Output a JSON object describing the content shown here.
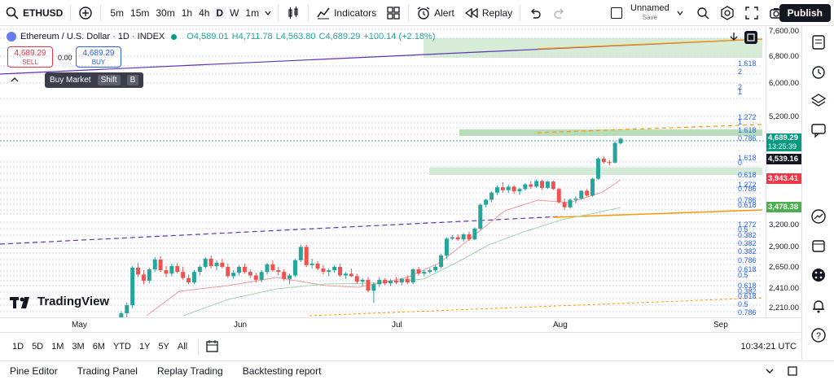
{
  "topbar": {
    "symbol": "ETHUSD",
    "timeframes": [
      "5m",
      "15m",
      "30m",
      "1h",
      "4h",
      "D",
      "W",
      "1m"
    ],
    "indicators": "Indicators",
    "alert": "Alert",
    "replay": "Replay",
    "layout_name": "Unnamed",
    "layout_state": "Save",
    "publish": "Publish"
  },
  "legend": {
    "title": "Ethereum / U.S. Dollar · 1D · INDEX",
    "open": "O4,589.01",
    "high": "H4,711.78",
    "low": "L4,563.80",
    "close": "C4,689.29",
    "change": "+100.14 (+2.18%)"
  },
  "trade": {
    "sell_price": "4,689.29",
    "sell_label": "SELL",
    "spread": "0.00",
    "buy_price": "4,689.29",
    "buy_label": "BUY"
  },
  "tooltip": {
    "action": "Buy Market",
    "key1": "Shift",
    "key2": "B"
  },
  "logo": "TradingView",
  "price_axis": {
    "ticks": [
      "7,600.00",
      "6,800.00",
      "6,000.00",
      "5,200.00",
      "3,200.00",
      "2,900.00",
      "2,650.00",
      "2,410.00",
      "2,210.00"
    ],
    "last_price": "4,689.29",
    "countdown": "13:25:39",
    "ref_price": "4,539.16",
    "red_level": "3,943.41",
    "green_level": "3,478.38"
  },
  "fib_labels": [
    "1.618",
    "2",
    "2",
    "1",
    "1.272",
    "1",
    "1.618",
    "0.786",
    "1.618",
    "0",
    "0.618",
    "1.272",
    "0.786",
    "0.786",
    "0.618",
    "1.272",
    "0.5",
    "0.382",
    "0.382",
    "0.382",
    "0.786",
    "0.618",
    "0.5",
    "0.618",
    "0.382",
    "0.618",
    "0.5",
    "0.786"
  ],
  "time_axis": [
    "May",
    "Jun",
    "Jul",
    "Aug",
    "Sep"
  ],
  "ranges": [
    "1D",
    "5D",
    "1M",
    "3M",
    "6M",
    "YTD",
    "1Y",
    "5Y",
    "All"
  ],
  "clock": "10:34:21 UTC",
  "bottom_tabs": [
    "Pine Editor",
    "Trading Panel",
    "Replay Trading",
    "Backtesting report"
  ],
  "colors": {
    "up": "#26a69a",
    "down": "#ef5350",
    "red_tag": "#f23645",
    "green_tag": "#4caf50",
    "ref_tag": "#131722",
    "last_tag": "#089981"
  },
  "chart_data": {
    "type": "candlestick",
    "x_labels": [
      "May",
      "Jun",
      "Jul",
      "Aug",
      "Sep"
    ],
    "y_range": [
      2100,
      7700
    ],
    "log_scale": true,
    "candles": [
      [
        1835,
        1990,
        1800,
        1960
      ],
      [
        1960,
        2120,
        1930,
        2100
      ],
      [
        2100,
        2210,
        2050,
        2180
      ],
      [
        2180,
        2610,
        2150,
        2590
      ],
      [
        2590,
        2650,
        2480,
        2510
      ],
      [
        2510,
        2560,
        2400,
        2440
      ],
      [
        2440,
        2590,
        2410,
        2570
      ],
      [
        2570,
        2720,
        2540,
        2690
      ],
      [
        2690,
        2730,
        2540,
        2560
      ],
      [
        2560,
        2610,
        2480,
        2520
      ],
      [
        2520,
        2640,
        2490,
        2610
      ],
      [
        2610,
        2650,
        2520,
        2540
      ],
      [
        2540,
        2600,
        2450,
        2470
      ],
      [
        2470,
        2510,
        2400,
        2420
      ],
      [
        2420,
        2560,
        2400,
        2540
      ],
      [
        2540,
        2620,
        2500,
        2600
      ],
      [
        2600,
        2720,
        2580,
        2700
      ],
      [
        2700,
        2740,
        2580,
        2610
      ],
      [
        2610,
        2680,
        2560,
        2650
      ],
      [
        2650,
        2700,
        2580,
        2600
      ],
      [
        2600,
        2640,
        2470,
        2490
      ],
      [
        2490,
        2560,
        2460,
        2530
      ],
      [
        2530,
        2620,
        2500,
        2600
      ],
      [
        2600,
        2640,
        2520,
        2540
      ],
      [
        2540,
        2570,
        2470,
        2500
      ],
      [
        2500,
        2530,
        2420,
        2450
      ],
      [
        2450,
        2560,
        2420,
        2540
      ],
      [
        2540,
        2650,
        2510,
        2630
      ],
      [
        2630,
        2680,
        2540,
        2560
      ],
      [
        2560,
        2600,
        2500,
        2540
      ],
      [
        2540,
        2570,
        2440,
        2460
      ],
      [
        2460,
        2520,
        2400,
        2500
      ],
      [
        2500,
        2700,
        2480,
        2680
      ],
      [
        2680,
        2880,
        2660,
        2850
      ],
      [
        2850,
        2880,
        2600,
        2620
      ],
      [
        2620,
        2700,
        2580,
        2640
      ],
      [
        2640,
        2670,
        2560,
        2580
      ],
      [
        2580,
        2620,
        2510,
        2540
      ],
      [
        2540,
        2580,
        2490,
        2560
      ],
      [
        2560,
        2620,
        2530,
        2600
      ],
      [
        2600,
        2640,
        2480,
        2500
      ],
      [
        2500,
        2540,
        2460,
        2520
      ],
      [
        2520,
        2580,
        2480,
        2490
      ],
      [
        2490,
        2520,
        2400,
        2430
      ],
      [
        2430,
        2470,
        2380,
        2450
      ],
      [
        2450,
        2480,
        2310,
        2330
      ],
      [
        2330,
        2420,
        2200,
        2400
      ],
      [
        2400,
        2480,
        2370,
        2450
      ],
      [
        2450,
        2470,
        2390,
        2410
      ],
      [
        2410,
        2460,
        2380,
        2440
      ],
      [
        2440,
        2480,
        2400,
        2420
      ],
      [
        2420,
        2470,
        2390,
        2460
      ],
      [
        2460,
        2500,
        2400,
        2420
      ],
      [
        2420,
        2580,
        2400,
        2570
      ],
      [
        2570,
        2600,
        2500,
        2520
      ],
      [
        2520,
        2560,
        2490,
        2540
      ],
      [
        2540,
        2580,
        2520,
        2560
      ],
      [
        2560,
        2620,
        2540,
        2600
      ],
      [
        2600,
        2760,
        2580,
        2740
      ],
      [
        2740,
        2980,
        2700,
        2960
      ],
      [
        2960,
        3010,
        2940,
        2980
      ],
      [
        2980,
        3020,
        2930,
        2950
      ],
      [
        2950,
        3040,
        2920,
        3020
      ],
      [
        3020,
        3060,
        2930,
        2950
      ],
      [
        2950,
        3120,
        2940,
        3100
      ],
      [
        3100,
        3480,
        3080,
        3460
      ],
      [
        3460,
        3560,
        3420,
        3540
      ],
      [
        3540,
        3680,
        3500,
        3660
      ],
      [
        3660,
        3780,
        3620,
        3750
      ],
      [
        3750,
        3840,
        3660,
        3700
      ],
      [
        3700,
        3800,
        3650,
        3760
      ],
      [
        3760,
        3790,
        3640,
        3680
      ],
      [
        3680,
        3740,
        3620,
        3720
      ],
      [
        3720,
        3820,
        3690,
        3800
      ],
      [
        3800,
        3860,
        3720,
        3760
      ],
      [
        3760,
        3890,
        3740,
        3860
      ],
      [
        3860,
        3880,
        3710,
        3740
      ],
      [
        3740,
        3860,
        3720,
        3850
      ],
      [
        3850,
        3870,
        3700,
        3720
      ],
      [
        3720,
        3740,
        3480,
        3500
      ],
      [
        3500,
        3560,
        3380,
        3420
      ],
      [
        3420,
        3560,
        3400,
        3540
      ],
      [
        3540,
        3600,
        3480,
        3560
      ],
      [
        3560,
        3700,
        3540,
        3690
      ],
      [
        3690,
        3720,
        3590,
        3610
      ],
      [
        3610,
        3920,
        3590,
        3900
      ],
      [
        3900,
        4300,
        3880,
        4280
      ],
      [
        4280,
        4330,
        4180,
        4210
      ],
      [
        4210,
        4250,
        4150,
        4200
      ],
      [
        4200,
        4640,
        4180,
        4600
      ],
      [
        4589.01,
        4711.78,
        4563.8,
        4689.29
      ]
    ]
  }
}
